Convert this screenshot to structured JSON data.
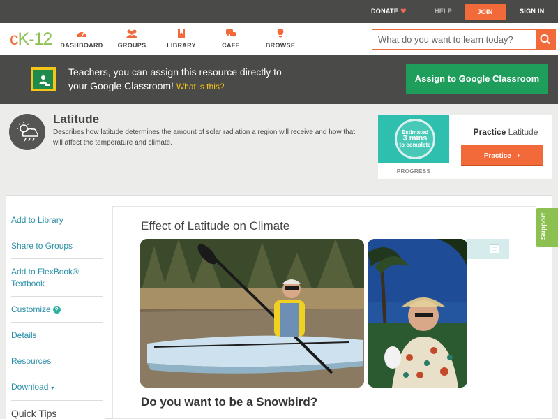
{
  "topbar": {
    "donate": "DONATE",
    "help": "HELP",
    "join": "JOIN",
    "signin": "SIGN IN"
  },
  "logo": {
    "c": "c",
    "k": "K",
    "dash": "-",
    "num": "12"
  },
  "nav": {
    "items": [
      {
        "label": "DASHBOARD",
        "icon": "dashboard-icon"
      },
      {
        "label": "GROUPS",
        "icon": "groups-icon"
      },
      {
        "label": "LIBRARY",
        "icon": "library-icon"
      },
      {
        "label": "CAFE",
        "icon": "cafe-icon"
      },
      {
        "label": "BROWSE",
        "icon": "browse-icon"
      }
    ],
    "search_placeholder": "What do you want to learn today?"
  },
  "banner": {
    "line1": "Teachers, you can assign this resource directly to",
    "line2": "your Google Classroom!",
    "what": "What is this?",
    "assign_label": "Assign to Google Classroom"
  },
  "concept": {
    "title": "Latitude",
    "description": "Describes how latitude determines the amount of solar radiation a region will receive and how that will affect the temperature and climate."
  },
  "practice": {
    "est_line1": "Estimated",
    "est_line2": "3 mins",
    "est_line3": "to complete",
    "progress_label": "PROGRESS",
    "title_bold": "Practice",
    "title_rest": "Latitude",
    "button_label": "Practice"
  },
  "sidebar": {
    "items": [
      "Add to Library",
      "Share to Groups",
      "Add to FlexBook®",
      "Textbook",
      "Customize",
      "Details",
      "Resources",
      "Download",
      "Quick Tips"
    ],
    "help_glyph": "?",
    "caret_glyph": "▾"
  },
  "article": {
    "title": "Effect of Latitude on Climate",
    "subheading": "Do you want to be a Snowbird?"
  },
  "support": {
    "label": "Support"
  },
  "colors": {
    "accent": "#f26a3a",
    "brand_green": "#8cc152",
    "dark_bar": "#4a4a48",
    "link": "#2a8fa8",
    "google_green": "#1e9e5a"
  }
}
